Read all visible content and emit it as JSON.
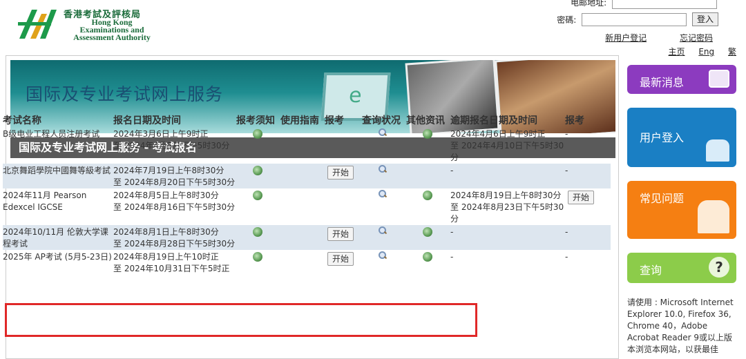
{
  "header": {
    "logo_cn": "香港考試及評核局",
    "logo_en_lines": [
      "Hong Kong",
      "Examinations and",
      "Assessment Authority"
    ],
    "email_label": "电邮地址:",
    "password_label": "密碼:",
    "login_button": "登入",
    "register_link": "新用户登记",
    "forgot_link": "忘记密码",
    "home_link": "主页",
    "eng_link": "Eng",
    "trad_link": "繁"
  },
  "banner": {
    "title": "国际及专业考试网上服务",
    "screen_letter": "e"
  },
  "section_title": "国际及专业考试网上服务 - 考试报名",
  "table": {
    "headers": [
      "考试名称",
      "报名日期及时间",
      "报考须知",
      "使用指南",
      "报考",
      "查询状况",
      "其他资讯",
      "逾期报名日期及时间",
      "报考"
    ],
    "start_label": "开始",
    "rows": [
      {
        "name": "B级电业工程人员注册考试",
        "period_line1": "2024年3月6日上午9时正",
        "period_line2": "至 2024年4月5日下午5时30分",
        "has_notice": true,
        "has_start": false,
        "has_status": true,
        "has_info": true,
        "late_line1": "2024年4月6日上午9时正",
        "late_line2": "至 2024年4月10日下午5时30分",
        "late_action": "-",
        "shaded": false
      },
      {
        "name": "北京舞蹈學院中國舞等級考試",
        "period_line1": "2024年7月19日上午8时30分",
        "period_line2": "至 2024年8月20日下午5时30分",
        "has_notice": true,
        "has_start": true,
        "has_status": true,
        "has_info": false,
        "late_line1": "-",
        "late_line2": "",
        "late_action": "-",
        "shaded": true
      },
      {
        "name": "2024年11月 Pearson Edexcel IGCSE",
        "period_line1": "2024年8月5日上午8时30分",
        "period_line2": "至 2024年8月16日下午5时30分",
        "has_notice": true,
        "has_start": false,
        "has_status": true,
        "has_info": true,
        "late_line1": "2024年8月19日上午8时30分",
        "late_line2": "至 2024年8月23日下午5时30分",
        "late_action": "开始",
        "shaded": false
      },
      {
        "name": "2024年10/11月 伦敦大学课程考试",
        "period_line1": "2024年8月1日上午8时30分",
        "period_line2": "至 2024年8月28日下午5时30分",
        "has_notice": true,
        "has_start": true,
        "has_status": true,
        "has_info": true,
        "late_line1": "-",
        "late_line2": "",
        "late_action": "-",
        "shaded": true
      },
      {
        "name": "2025年 AP考试 (5月5-23日)",
        "period_line1": "2024年8月19日上午10时正",
        "period_line2": "至 2024年10月31日下午5时正",
        "has_notice": true,
        "has_start": true,
        "has_status": true,
        "has_info": true,
        "late_line1": "-",
        "late_line2": "",
        "late_action": "-",
        "shaded": false
      }
    ]
  },
  "sidebar": {
    "news": "最新消息",
    "user_login": "用户登入",
    "faq": "常见问题",
    "query": "查询",
    "query_icon": "?",
    "note": "请使用 : Microsoft Internet Explorer 10.0, Firefox 36, Chrome 40，Adobe Acrobat Reader 9或以上版本浏览本网站，以获最佳"
  },
  "colors": {
    "news": "#8c3bbf",
    "login": "#1a7fc4",
    "faq": "#f57f12",
    "query": "#8ccc4a",
    "section_bar": "#5a5a5a",
    "highlight": "#e02828"
  },
  "icons": {
    "notice": "document-globe-icon",
    "status": "magnifier-icon",
    "info": "info-globe-icon"
  }
}
